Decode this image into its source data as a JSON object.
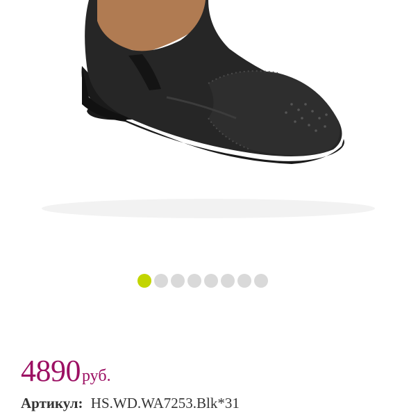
{
  "gallery": {
    "image_icon": "black-leather-slip-on-shoe",
    "slides_total": 8,
    "active_index": 0
  },
  "price": {
    "value": "4890",
    "currency": "руб."
  },
  "sku": {
    "label": "Артикул:",
    "value": "HS.WD.WA7253.Blk*31"
  },
  "colors": {
    "price": "#9c1063",
    "active_dot": "#c2d500",
    "inactive_dot": "#d9d9d9"
  }
}
